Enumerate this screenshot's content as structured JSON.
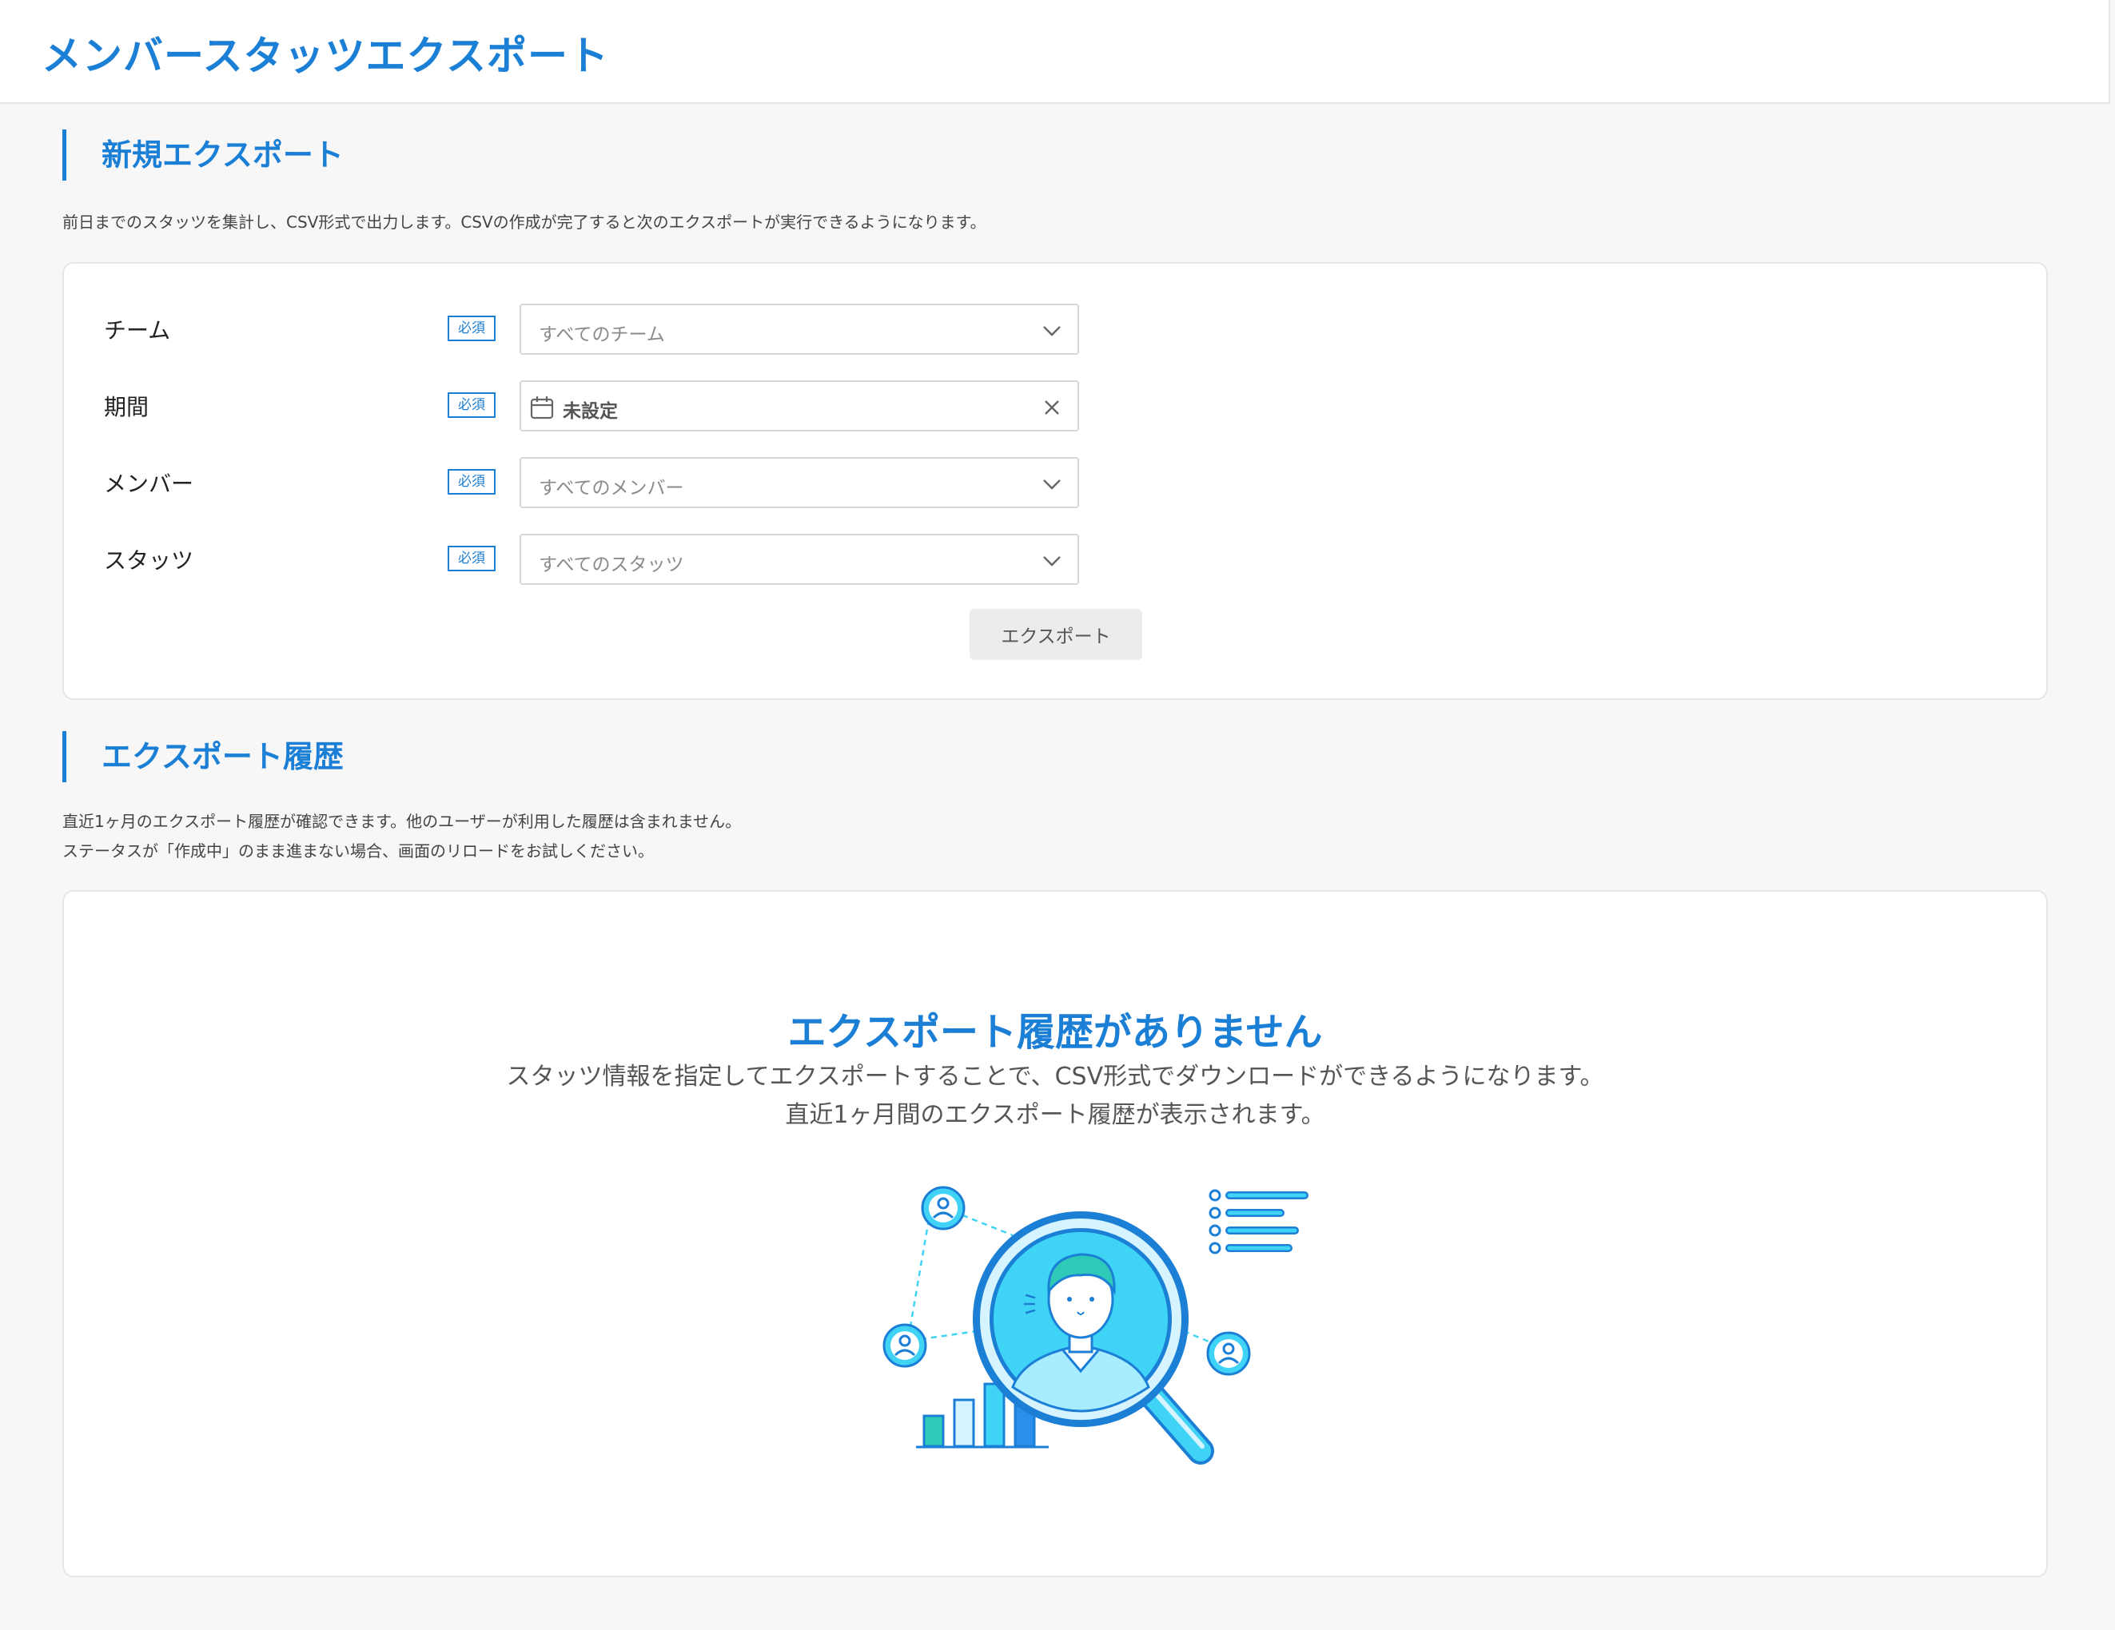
{
  "header": {
    "title": "メンバースタッツエクスポート"
  },
  "new_export": {
    "title": "新規エクスポート",
    "description": "前日までのスタッツを集計し、CSV形式で出力します。CSVの作成が完了すると次のエクスポートが実行できるようになります。",
    "fields": [
      {
        "label": "チーム",
        "badge": "必須",
        "placeholder": "すべてのチーム",
        "icon": "chevron-down-icon"
      },
      {
        "label": "期間",
        "badge": "必須",
        "value": "未設定",
        "icon_left": "calendar-icon",
        "icon": "close-icon"
      },
      {
        "label": "メンバー",
        "badge": "必須",
        "placeholder": "すべてのメンバー",
        "icon": "chevron-down-icon"
      },
      {
        "label": "スタッツ",
        "badge": "必須",
        "placeholder": "すべてのスタッツ",
        "icon": "chevron-down-icon"
      }
    ],
    "export_button": "エクスポート"
  },
  "history": {
    "title": "エクスポート履歴",
    "description_line1": "直近1ヶ月のエクスポート履歴が確認できます。他のユーザーが利用した履歴は含まれません。",
    "description_line2": "ステータスが「作成中」のまま進まない場合、画面のリロードをお試しください。",
    "empty_title": "エクスポート履歴がありません",
    "empty_text_line1": "スタッツ情報を指定してエクスポートすることで、CSV形式でダウンロードができるようになります。",
    "empty_text_line2": "直近1ヶ月間のエクスポート履歴が表示されます。"
  },
  "colors": {
    "accent": "#1c7fd6",
    "illustration_cyan": "#3fd3f5",
    "background": "#f7f7f7"
  }
}
